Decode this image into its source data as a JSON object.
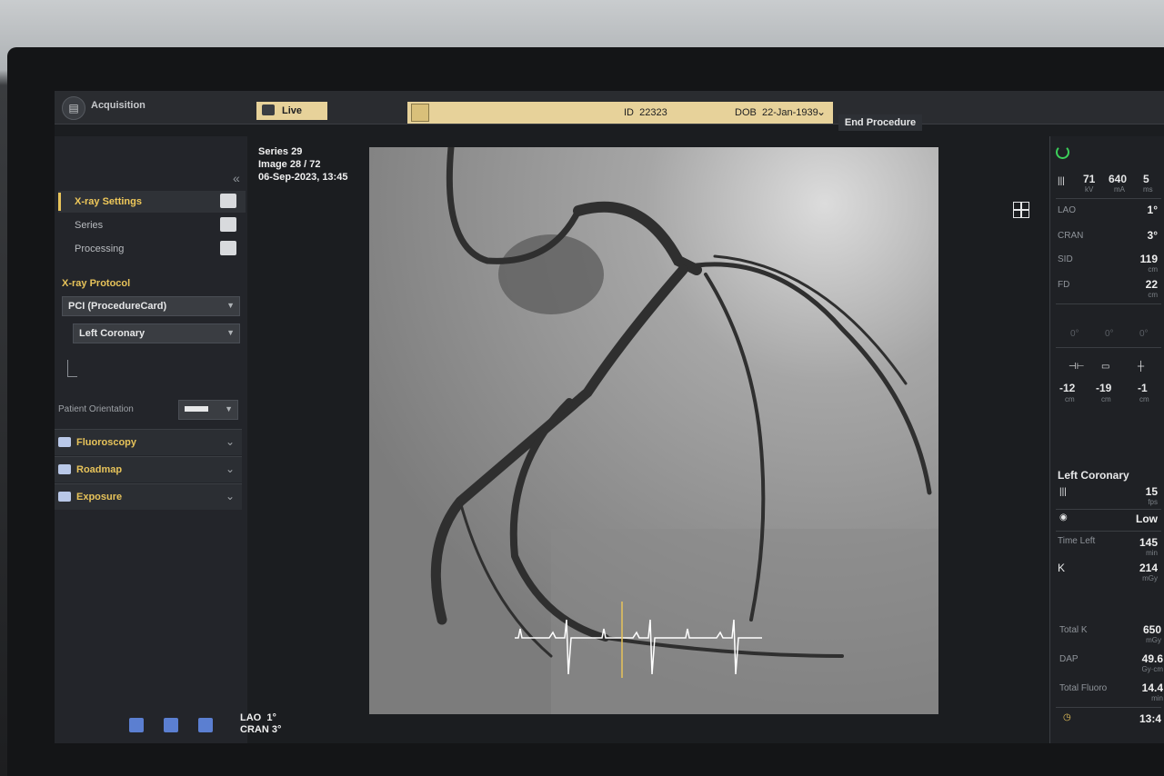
{
  "topbar": {
    "acquisition_label": "Acquisition",
    "live_tab": "Live",
    "patient_id_label": "ID",
    "patient_id": "22323",
    "dob_label": "DOB",
    "dob": "22-Jan-1939",
    "end_procedure": "End Procedure"
  },
  "sidebar": {
    "items": [
      {
        "label": "X-ray Settings",
        "icon": "xray-settings-icon",
        "active": true
      },
      {
        "label": "Series",
        "icon": "series-icon",
        "active": false
      },
      {
        "label": "Processing",
        "icon": "processing-icon",
        "active": false
      }
    ],
    "protocol_title": "X-ray Protocol",
    "protocol": "PCI (ProcedureCard)",
    "sub_protocol": "Left Coronary",
    "orientation_label": "Patient Orientation",
    "sections": [
      {
        "label": "Fluoroscopy",
        "icon": "eye-icon"
      },
      {
        "label": "Roadmap",
        "icon": "roadmap-icon"
      },
      {
        "label": "Exposure",
        "icon": "exposure-icon"
      }
    ]
  },
  "image_info": {
    "series": "Series 29",
    "image": "Image 28 / 72",
    "datetime": "06-Sep-2023, 13:45"
  },
  "bottom_orientation": {
    "lao_label": "LAO",
    "lao_value": "1°",
    "cran_label": "CRAN",
    "cran_value": "3°"
  },
  "right_panel": {
    "kv": "71",
    "kv_unit": "kV",
    "ma": "640",
    "ma_unit": "mA",
    "ms": "5",
    "ms_unit": "ms",
    "lao_label": "LAO",
    "lao_value": "1°",
    "cran_label": "CRAN",
    "cran_value": "3°",
    "sid_label": "SID",
    "sid_value": "119",
    "sid_unit": "cm",
    "fd_label": "FD",
    "fd_value": "22",
    "fd_unit": "cm",
    "angles": [
      "0°",
      "0°",
      "0°"
    ],
    "table_pos": [
      {
        "value": "-12",
        "unit": "cm"
      },
      {
        "value": "-19",
        "unit": "cm"
      },
      {
        "value": "-1",
        "unit": "cm"
      }
    ],
    "protocol_title": "Left Coronary",
    "fps": "15",
    "fps_unit": "fps",
    "dose_level": "Low",
    "time_left_label": "Time Left",
    "time_left": "145",
    "time_left_unit": "min",
    "k_label": "K",
    "k_value": "214",
    "k_unit": "mGy",
    "total_k_label": "Total K",
    "total_k": "650",
    "total_k_unit": "mGy",
    "dap_label": "DAP",
    "dap": "49.6",
    "dap_unit": "Gy·cm",
    "total_fluoro_label": "Total Fluoro",
    "total_fluoro": "14.4",
    "total_fluoro_unit": "min",
    "clock": "13:4"
  },
  "colors": {
    "accent": "#e7c35a",
    "status_green": "#3ccf5a",
    "tab_bg": "#e7d29a"
  }
}
